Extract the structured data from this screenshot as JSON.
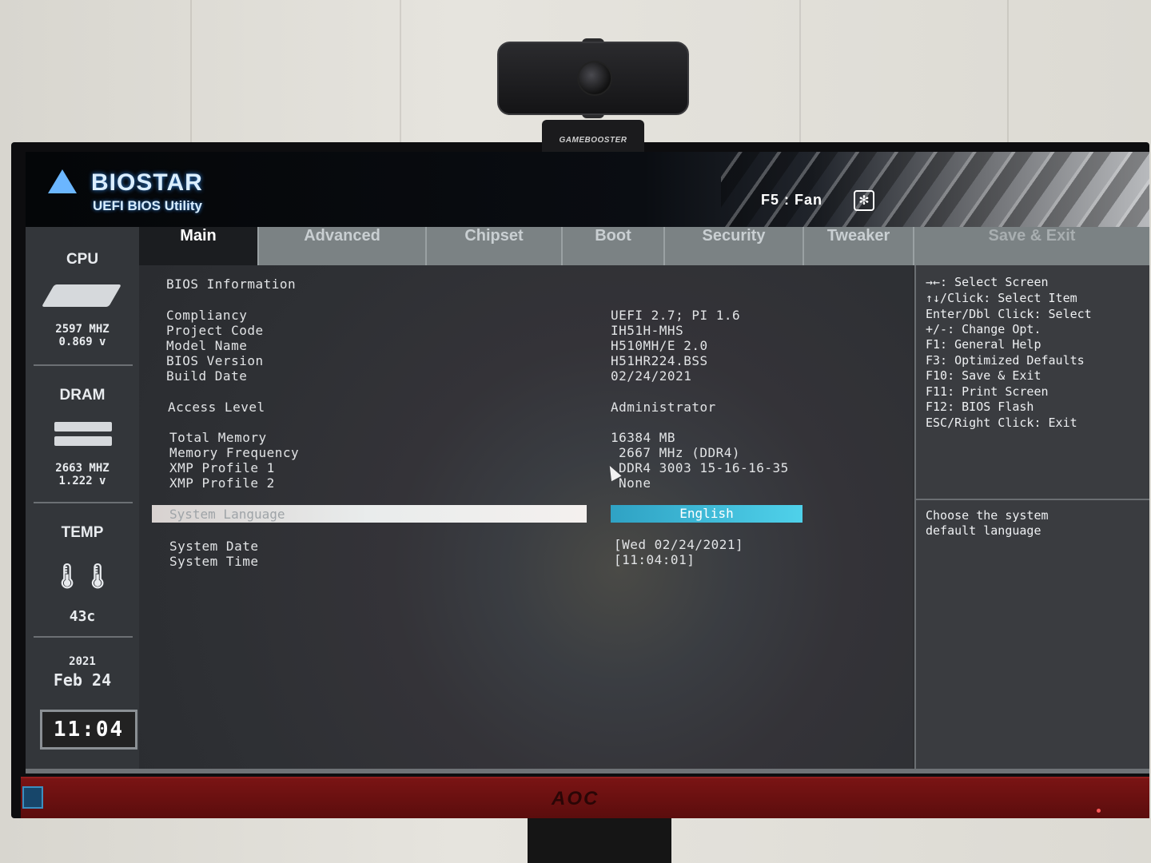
{
  "webcam": {
    "clip_label": "GAMEBOOSTER"
  },
  "monitor": {
    "logo": "AOC"
  },
  "header": {
    "brand": "BIOSTAR",
    "subtitle": "UEFI BIOS Utility",
    "fan_hint": "F5 : Fan"
  },
  "tabs": [
    {
      "label": "Main",
      "active": true
    },
    {
      "label": "Advanced"
    },
    {
      "label": "Chipset"
    },
    {
      "label": "Boot"
    },
    {
      "label": "Security"
    },
    {
      "label": "Tweaker"
    },
    {
      "label": "Save & Exit"
    }
  ],
  "side": {
    "cpu": {
      "title": "CPU",
      "freq": "2597 MHZ",
      "volt": "0.869 v"
    },
    "dram": {
      "title": "DRAM",
      "freq": "2663 MHZ",
      "volt": "1.222 v"
    },
    "temp": {
      "title": "TEMP",
      "value": "43c"
    },
    "date": {
      "year": "2021",
      "month_day": "Feb 24"
    },
    "clock": "11:04"
  },
  "main": {
    "section_title": "BIOS Information",
    "rows": [
      {
        "label": "Compliancy",
        "value": "UEFI 2.7; PI 1.6"
      },
      {
        "label": "Project Code",
        "value": "IH51H-MHS"
      },
      {
        "label": "Model Name",
        "value": "H510MH/E 2.0"
      },
      {
        "label": "BIOS Version",
        "value": "H51HR224.BSS"
      },
      {
        "label": "Build Date",
        "value": "02/24/2021"
      },
      {
        "label": "Access Level",
        "value": "Administrator"
      },
      {
        "label": "Total Memory",
        "value": "16384 MB"
      },
      {
        "label": "Memory Frequency",
        "value": "2667 MHz (DDR4)"
      },
      {
        "label": "XMP Profile 1",
        "value": "DDR4 3003 15-16-16-35"
      },
      {
        "label": "XMP Profile 2",
        "value": "None"
      },
      {
        "label": "System Date",
        "value": "[Wed 02/24/2021]"
      },
      {
        "label": "System Time",
        "value": "[11:04:01]"
      }
    ],
    "selected": {
      "label": "System Language",
      "value": "English"
    }
  },
  "help": {
    "keys": [
      "→←: Select Screen",
      "↑↓/Click: Select Item",
      "Enter/Dbl Click: Select",
      "+/-: Change Opt.",
      "F1: General Help",
      "F3: Optimized Defaults",
      "F10: Save & Exit",
      "F11: Print Screen",
      "F12: BIOS Flash",
      "ESC/Right Click: Exit"
    ],
    "description_1": "Choose the system",
    "description_2": "default language"
  },
  "colors": {
    "accent_selected": "#3fbfdc",
    "tab_active_bg": "#1b1d20",
    "bezel_red": "#7a1414"
  }
}
